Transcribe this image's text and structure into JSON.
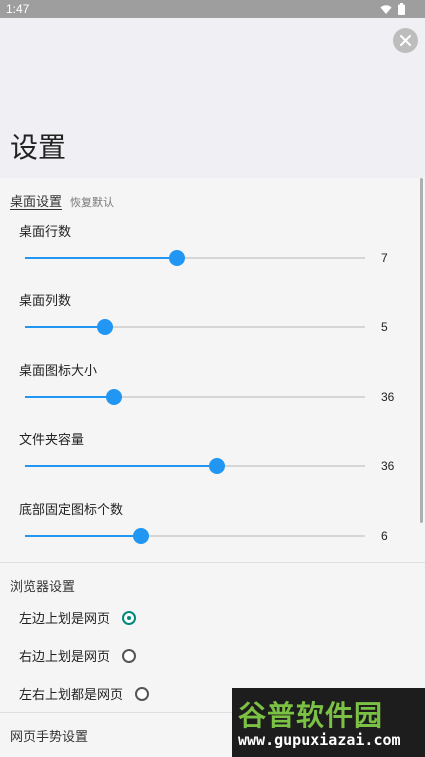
{
  "status_bar": {
    "time": "1:47"
  },
  "header": {
    "title": "设置"
  },
  "desktop_section": {
    "title": "桌面设置",
    "reset_label": "恢复默认",
    "sliders": [
      {
        "label": "桌面行数",
        "value": "7",
        "fraction": 0.448
      },
      {
        "label": "桌面列数",
        "value": "5",
        "fraction": 0.235
      },
      {
        "label": "桌面图标大小",
        "value": "36",
        "fraction": 0.262
      },
      {
        "label": "文件夹容量",
        "value": "36",
        "fraction": 0.565
      },
      {
        "label": "底部固定图标个数",
        "value": "6",
        "fraction": 0.342
      }
    ]
  },
  "browser_section": {
    "title": "浏览器设置",
    "options": [
      {
        "label": "左边上划是网页",
        "checked": true
      },
      {
        "label": "右边上划是网页",
        "checked": false
      },
      {
        "label": "左右上划都是网页",
        "checked": false
      }
    ]
  },
  "gesture_section": {
    "title": "网页手势设置"
  },
  "watermark": {
    "logo": "谷普软件园",
    "url": "www.gupuxiazai.com"
  },
  "colors": {
    "accent": "#2196f3",
    "radio_checked": "#00897b",
    "header_bg": "#efeff4"
  },
  "icons": [
    "wifi-icon",
    "battery-icon",
    "close-icon"
  ]
}
